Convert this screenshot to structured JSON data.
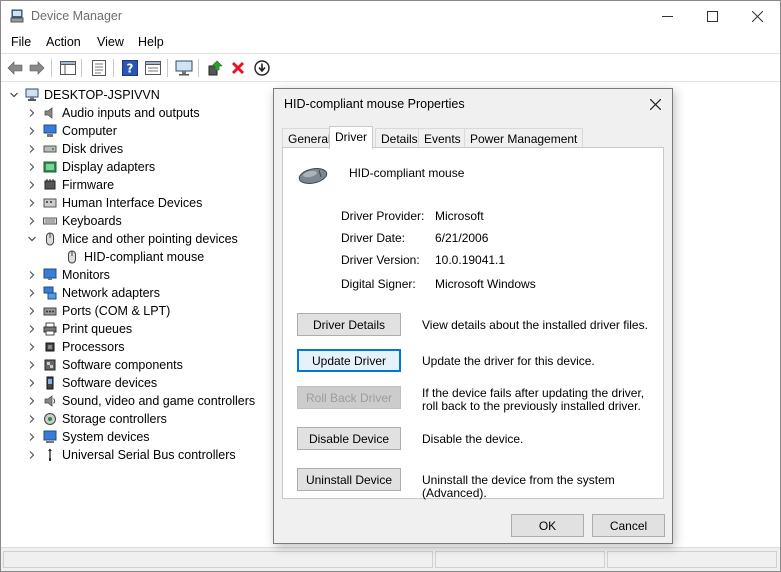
{
  "window": {
    "title": "Device Manager",
    "menu": [
      "File",
      "Action",
      "View",
      "Help"
    ]
  },
  "toolbar": {
    "icons": [
      "back-arrow-icon",
      "forward-arrow-icon",
      "show-hide-tree-icon",
      "properties-icon",
      "help-icon",
      "view-icon",
      "monitor-scan-icon",
      "update-driver-icon",
      "uninstall-x-icon",
      "disable-icon"
    ]
  },
  "tree": {
    "root": "DESKTOP-JSPIVVN",
    "items": [
      {
        "label": "Audio inputs and outputs",
        "icon": "speaker-icon",
        "expanded": false
      },
      {
        "label": "Computer",
        "icon": "computer-icon",
        "expanded": false
      },
      {
        "label": "Disk drives",
        "icon": "disk-icon",
        "expanded": false
      },
      {
        "label": "Display adapters",
        "icon": "display-adapter-icon",
        "expanded": false
      },
      {
        "label": "Firmware",
        "icon": "firmware-icon",
        "expanded": false
      },
      {
        "label": "Human Interface Devices",
        "icon": "hid-icon",
        "expanded": false
      },
      {
        "label": "Keyboards",
        "icon": "keyboard-icon",
        "expanded": false
      },
      {
        "label": "Mice and other pointing devices",
        "icon": "mouse-icon",
        "expanded": true
      },
      {
        "label": "HID-compliant mouse",
        "icon": "mouse-icon",
        "child": true
      },
      {
        "label": "Monitors",
        "icon": "monitor-icon",
        "expanded": false
      },
      {
        "label": "Network adapters",
        "icon": "network-icon",
        "expanded": false
      },
      {
        "label": "Ports (COM & LPT)",
        "icon": "port-icon",
        "expanded": false
      },
      {
        "label": "Print queues",
        "icon": "printer-icon",
        "expanded": false
      },
      {
        "label": "Processors",
        "icon": "processor-icon",
        "expanded": false
      },
      {
        "label": "Software components",
        "icon": "software-component-icon",
        "expanded": false
      },
      {
        "label": "Software devices",
        "icon": "software-device-icon",
        "expanded": false
      },
      {
        "label": "Sound, video and game controllers",
        "icon": "sound-icon",
        "expanded": false
      },
      {
        "label": "Storage controllers",
        "icon": "storage-icon",
        "expanded": false
      },
      {
        "label": "System devices",
        "icon": "system-icon",
        "expanded": false
      },
      {
        "label": "Universal Serial Bus controllers",
        "icon": "usb-icon",
        "expanded": false
      }
    ]
  },
  "dialog": {
    "title": "HID-compliant mouse Properties",
    "tabs": [
      "General",
      "Driver",
      "Details",
      "Events",
      "Power Management"
    ],
    "active_tab": "Driver",
    "device_name": "HID-compliant mouse",
    "fields": [
      {
        "label": "Driver Provider:",
        "value": "Microsoft"
      },
      {
        "label": "Driver Date:",
        "value": "6/21/2006"
      },
      {
        "label": "Driver Version:",
        "value": "10.0.19041.1"
      },
      {
        "label": "Digital Signer:",
        "value": "Microsoft Windows"
      }
    ],
    "actions": [
      {
        "label": "Driver Details",
        "desc": "View details about the installed driver files.",
        "state": "normal"
      },
      {
        "label": "Update Driver",
        "desc": "Update the driver for this device.",
        "state": "focused"
      },
      {
        "label": "Roll Back Driver",
        "desc": "If the device fails after updating the driver, roll back to the previously installed driver.",
        "state": "disabled"
      },
      {
        "label": "Disable Device",
        "desc": "Disable the device.",
        "state": "normal"
      },
      {
        "label": "Uninstall Device",
        "desc": "Uninstall the device from the system (Advanced).",
        "state": "normal"
      }
    ],
    "ok_label": "OK",
    "cancel_label": "Cancel"
  },
  "colors": {
    "focus_blue": "#0078d7",
    "delete_red": "#e81123",
    "title_gray": "#6d6d6d"
  }
}
